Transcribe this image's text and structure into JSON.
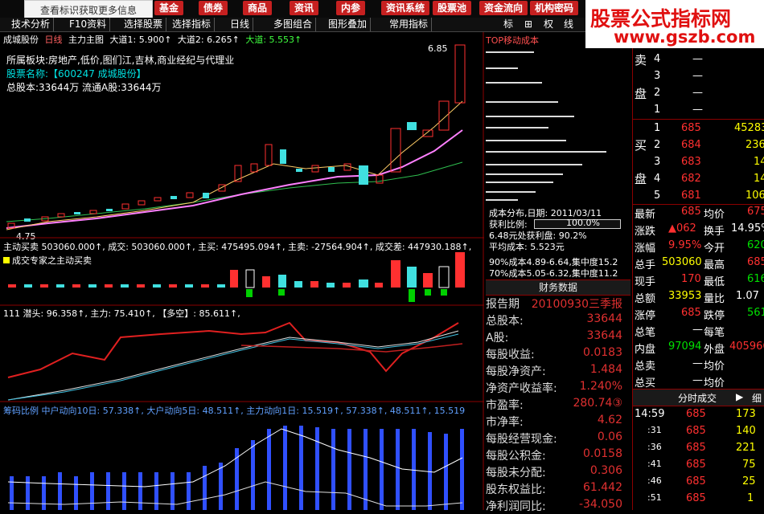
{
  "top_nav": {
    "tooltip": "查看标识获取更多信息",
    "buttons": [
      {
        "label": "基金"
      },
      {
        "label": "债券"
      },
      {
        "label": "商品"
      },
      {
        "label": "资讯"
      },
      {
        "label": "内参"
      },
      {
        "label": "资讯系统"
      },
      {
        "label": "股票池"
      },
      {
        "label": "资金流向"
      },
      {
        "label": "机构密码"
      }
    ]
  },
  "toolbar": {
    "items": [
      "技术分析",
      "F10资料",
      "选择股票",
      "选择指标",
      "日线",
      "多图组合",
      "图形叠加",
      "常用指标"
    ],
    "right_items": [
      "标",
      "⊞",
      "权",
      "线"
    ]
  },
  "watermark": {
    "line1": "股票公式指标网",
    "line2": "www.gszb.com"
  },
  "main_chart": {
    "header": {
      "name": "成城股份",
      "period": "日线",
      "main_label": "主力主图",
      "d1": "大道1: 5.900↑",
      "d2": "大道2: 6.265↑",
      "d3": "大道: 5.553↑"
    },
    "info": {
      "sector": "所属板块:房地产,低价,图们江,吉林,商业经纪与代理业",
      "name": "股票名称:【600247 成城股份】",
      "capital": "总股本:33644万   流通A股:33644万"
    },
    "high_label": "6.85",
    "low_label": "4.75"
  },
  "volume_panel": {
    "line": "主动买卖 503060.000↑, 成交: 503060.000↑, 主买: 475495.094↑, 主卖: -27564.904↑, 成交差: 447930.188↑,",
    "subtitle": "成交专家之主动买卖"
  },
  "trend_panel": {
    "line": "111  潜头: 96.358↑, 主力: 75.410↑, 【多空】: 85.611↑,"
  },
  "chip_panel": {
    "line": "筹码比例  中户动向10日: 57.338↑, 大户动向5日: 48.511↑, 主力动向1日: 15.519↑,  57.338↑, 48.511↑, 15.519"
  },
  "tor_panel": {
    "title": "TOP移动成本",
    "date": "成本分布,日期: 2011/03/11",
    "profit": "获利比例:",
    "profit_pct": "100.0%",
    "profit_at": "6.48元处获利盘: 90.2%",
    "avg": "平均成本: 5.523元",
    "c90": "90%成本4.89-6.64,集中度15.2",
    "c70": "70%成本5.05-6.32,集中度11.2"
  },
  "finance": {
    "header": "财务数据",
    "rows": [
      {
        "k": "报告期",
        "v": "20100930三季报"
      },
      {
        "k": "总股本:",
        "v": "33644"
      },
      {
        "k": "A股:",
        "v": "33644"
      },
      {
        "k": "每股收益:",
        "v": "0.0183"
      },
      {
        "k": "每股净资产:",
        "v": "1.484"
      },
      {
        "k": "净资产收益率:",
        "v": "1.240%"
      },
      {
        "k": "市盈率:",
        "v": "280.74③"
      },
      {
        "k": "市净率:",
        "v": "4.62"
      },
      {
        "k": "每股经营现金:",
        "v": "0.06"
      },
      {
        "k": "每股公积金:",
        "v": "0.0158"
      },
      {
        "k": "每股未分配:",
        "v": "0.306"
      },
      {
        "k": "股东权益比:",
        "v": "61.442"
      },
      {
        "k": "净利润同比:",
        "v": "-34.050"
      }
    ]
  },
  "quote": {
    "sell_label": [
      "卖",
      "盘"
    ],
    "buy_label": [
      "买",
      "盘"
    ],
    "sell": [
      {
        "n": "4",
        "p": "—",
        "v": ""
      },
      {
        "n": "3",
        "p": "—",
        "v": ""
      },
      {
        "n": "2",
        "p": "—",
        "v": ""
      },
      {
        "n": "1",
        "p": "—",
        "v": ""
      }
    ],
    "buy": [
      {
        "n": "1",
        "p": "685",
        "v": "45283"
      },
      {
        "n": "2",
        "p": "684",
        "v": "236"
      },
      {
        "n": "3",
        "p": "683",
        "v": "14"
      },
      {
        "n": "4",
        "p": "682",
        "v": "14"
      },
      {
        "n": "5",
        "p": "681",
        "v": "106"
      }
    ],
    "stats": [
      [
        "最新",
        "685",
        "均价",
        "675"
      ],
      [
        "涨跌",
        "▲062",
        "换手",
        "14.95%"
      ],
      [
        "涨幅",
        "9.95%",
        "今开",
        "620"
      ],
      [
        "总手",
        "503060",
        "最高",
        "685"
      ],
      [
        "现手",
        "170",
        "最低",
        "616"
      ],
      [
        "总额",
        "33953",
        "量比",
        "1.07"
      ],
      [
        "涨停",
        "685",
        "跌停",
        "561"
      ],
      [
        "总笔",
        "—",
        "每笔",
        ""
      ],
      [
        "内盘",
        "97094",
        "外盘",
        "405966"
      ],
      [
        "总卖",
        "—",
        "均价",
        ""
      ],
      [
        "总买",
        "—",
        "均价",
        ""
      ]
    ],
    "tick_header": "分时成交",
    "tick_header2": "细",
    "ticks": [
      {
        "t": "14:59",
        "p": "685",
        "v": "173"
      },
      {
        "t": ":31",
        "p": "685",
        "v": "140"
      },
      {
        "t": ":36",
        "p": "685",
        "v": "221"
      },
      {
        "t": ":41",
        "p": "685",
        "v": "75"
      },
      {
        "t": ":46",
        "p": "685",
        "v": "25"
      },
      {
        "t": ":51",
        "p": "685",
        "v": "1"
      }
    ]
  }
}
